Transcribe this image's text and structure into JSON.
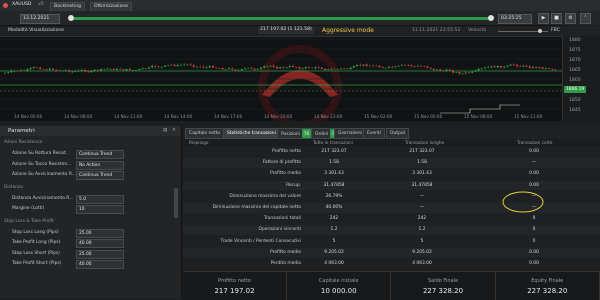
{
  "topbar": {
    "symbol": "XAUUSD",
    "version": "v5",
    "tabs": [
      "Backtesting",
      "Ottimizzazione"
    ]
  },
  "toolbar": {
    "date_start": "13.12.2021",
    "time_end": "03:25:25",
    "play": "▶",
    "stop": "■"
  },
  "chart": {
    "title": "Modalità Visualizzazione",
    "info": "217 197.02 (1 121.58)",
    "mode": "Aggressive mode",
    "info_right": "11.11.2021 23:55:52",
    "velocity": "Velocità",
    "right_tag": "FBC",
    "x_labels": [
      "14 Nov 05:00",
      "14 Nov 08:00",
      "14 Nov 11:00",
      "14 Nov 14:00",
      "14 Nov 17:00",
      "14 Nov 20:00",
      "14 Nov 23:00",
      "15 Nov 02:00",
      "15 Nov 05:00",
      "15 Nov 08:00",
      "15 Nov 11:00"
    ],
    "y_labels": [
      "1880",
      "1875",
      "1870",
      "1865",
      "1860",
      "1855",
      "1850",
      "1845"
    ],
    "price_tag": "1866.19"
  },
  "left": {
    "title": "Parametri",
    "sections": [
      {
        "name": "Azioni Resistenza",
        "rows": [
          {
            "label": "Azione Su Rottura Resist.",
            "value": "Continua Trend"
          },
          {
            "label": "Azione Su Tocco Resisten...",
            "value": "No Action"
          },
          {
            "label": "Azione Su Avvicinamento R...",
            "value": "Continua Trend"
          }
        ]
      },
      {
        "name": "Distanza",
        "rows": [
          {
            "label": "Distanza Avvicinamento R...",
            "value": "5.0"
          },
          {
            "label": "Margine (Lotti)",
            "value": "10"
          }
        ]
      },
      {
        "name": "Stop Loss & Take Profit",
        "rows": [
          {
            "label": "Stop Loss Long (Pips)",
            "value": "25.00"
          },
          {
            "label": "Take Profit Long (Pips)",
            "value": "40.00"
          },
          {
            "label": "Stop Loss Short (Pips)",
            "value": "25.00"
          },
          {
            "label": "Take Profit Short (Pips)",
            "value": "40.00"
          }
        ]
      }
    ]
  },
  "right": {
    "tabs": [
      {
        "label": "Capitale netto"
      },
      {
        "label": "Statistiche transazioni"
      },
      {
        "label": "Posizioni",
        "badge": "70"
      },
      {
        "label": "Ordini",
        "badge": "0"
      },
      {
        "label": "Giornaliero"
      },
      {
        "label": "Eventi"
      },
      {
        "label": "Output"
      }
    ],
    "headers": [
      "Riepilogo",
      "Tutte le transazioni",
      "Transazioni lunghe",
      "Transazioni corte"
    ],
    "rows": [
      {
        "label": "Profitto netto",
        "v": [
          "217 323.07",
          "217 323.07",
          "0.00"
        ]
      },
      {
        "label": "Fattore di profitto",
        "v": [
          "1.58",
          "1.58",
          "—"
        ]
      },
      {
        "label": "Profitto medio",
        "v": [
          "3 301.43",
          "3 301.43",
          "0.00"
        ]
      },
      {
        "label": "Recup.",
        "v": [
          "31.47858",
          "31.47858",
          "0.00"
        ]
      },
      {
        "label": "Diminuzione massima del valore",
        "v": [
          "26.79%",
          "—",
          "—"
        ]
      },
      {
        "label": "Diminuzione massima del capitale netto",
        "v": [
          "40.00%",
          "—",
          "—"
        ]
      },
      {
        "label": "Transazioni totali",
        "v": [
          "242",
          "242",
          "0"
        ]
      },
      {
        "label": "Operazioni vincenti",
        "v": [
          "1.2",
          "1.2",
          "0"
        ]
      },
      {
        "label": "Trade Vincenti / Perdenti Consecutivi",
        "v": [
          "5",
          "5",
          "0"
        ]
      },
      {
        "label": "Profitto medio",
        "v": [
          "9 205.02",
          "9 205.02",
          "0.00"
        ]
      },
      {
        "label": "Perdita media",
        "v": [
          "4 063.00",
          "4 063.00",
          "0.00"
        ]
      }
    ],
    "summary": [
      {
        "label": "Profitto netto",
        "value": "217 197.02"
      },
      {
        "label": "Capitale iniziale",
        "value": "10 000.00"
      },
      {
        "label": "Saldo Finale",
        "value": "227 328.20"
      },
      {
        "label": "Equity Finale",
        "value": "227 328.20"
      }
    ]
  },
  "colors": {
    "progress": "#2f9a47",
    "bull": "#3aa34a",
    "bear": "#d3473f",
    "highlight": "#e6d23a",
    "mode_text": "#f2c94c"
  }
}
